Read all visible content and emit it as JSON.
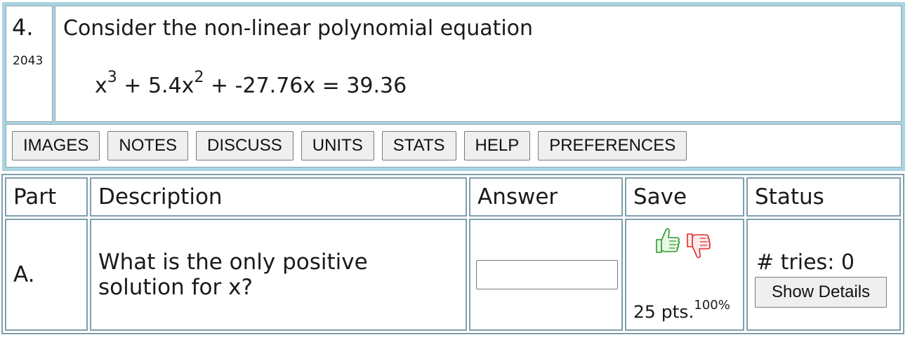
{
  "question": {
    "number": "4.",
    "id": "2043",
    "intro": "Consider the non-linear polynomial equation",
    "equation": {
      "x1": "x",
      "exp1": "3",
      "mid1": " + 5.4x",
      "exp2": "2",
      "rest": " + -27.76x = 39.36"
    }
  },
  "toolbar": {
    "buttons": [
      "IMAGES",
      "NOTES",
      "DISCUSS",
      "UNITS",
      "STATS",
      "HELP",
      "PREFERENCES"
    ]
  },
  "table": {
    "headers": {
      "part": "Part",
      "description": "Description",
      "answer": "Answer",
      "save": "Save",
      "status": "Status"
    },
    "rows": [
      {
        "part": "A.",
        "description": "What is the only positive solution for x?",
        "answer_value": "",
        "answer_placeholder": "",
        "points": "25 pts.",
        "points_pct": "100%",
        "tries": "# tries: 0",
        "show_details": "Show Details"
      }
    ]
  },
  "colors": {
    "frame": "#a9d4e2",
    "border": "#7f9fac",
    "thumb_up": "#2e9b2e",
    "thumb_down": "#e03030",
    "button_bg": "#efefef"
  },
  "icons": {
    "save_up": "thumbs-up-icon",
    "save_down": "thumbs-down-icon"
  }
}
